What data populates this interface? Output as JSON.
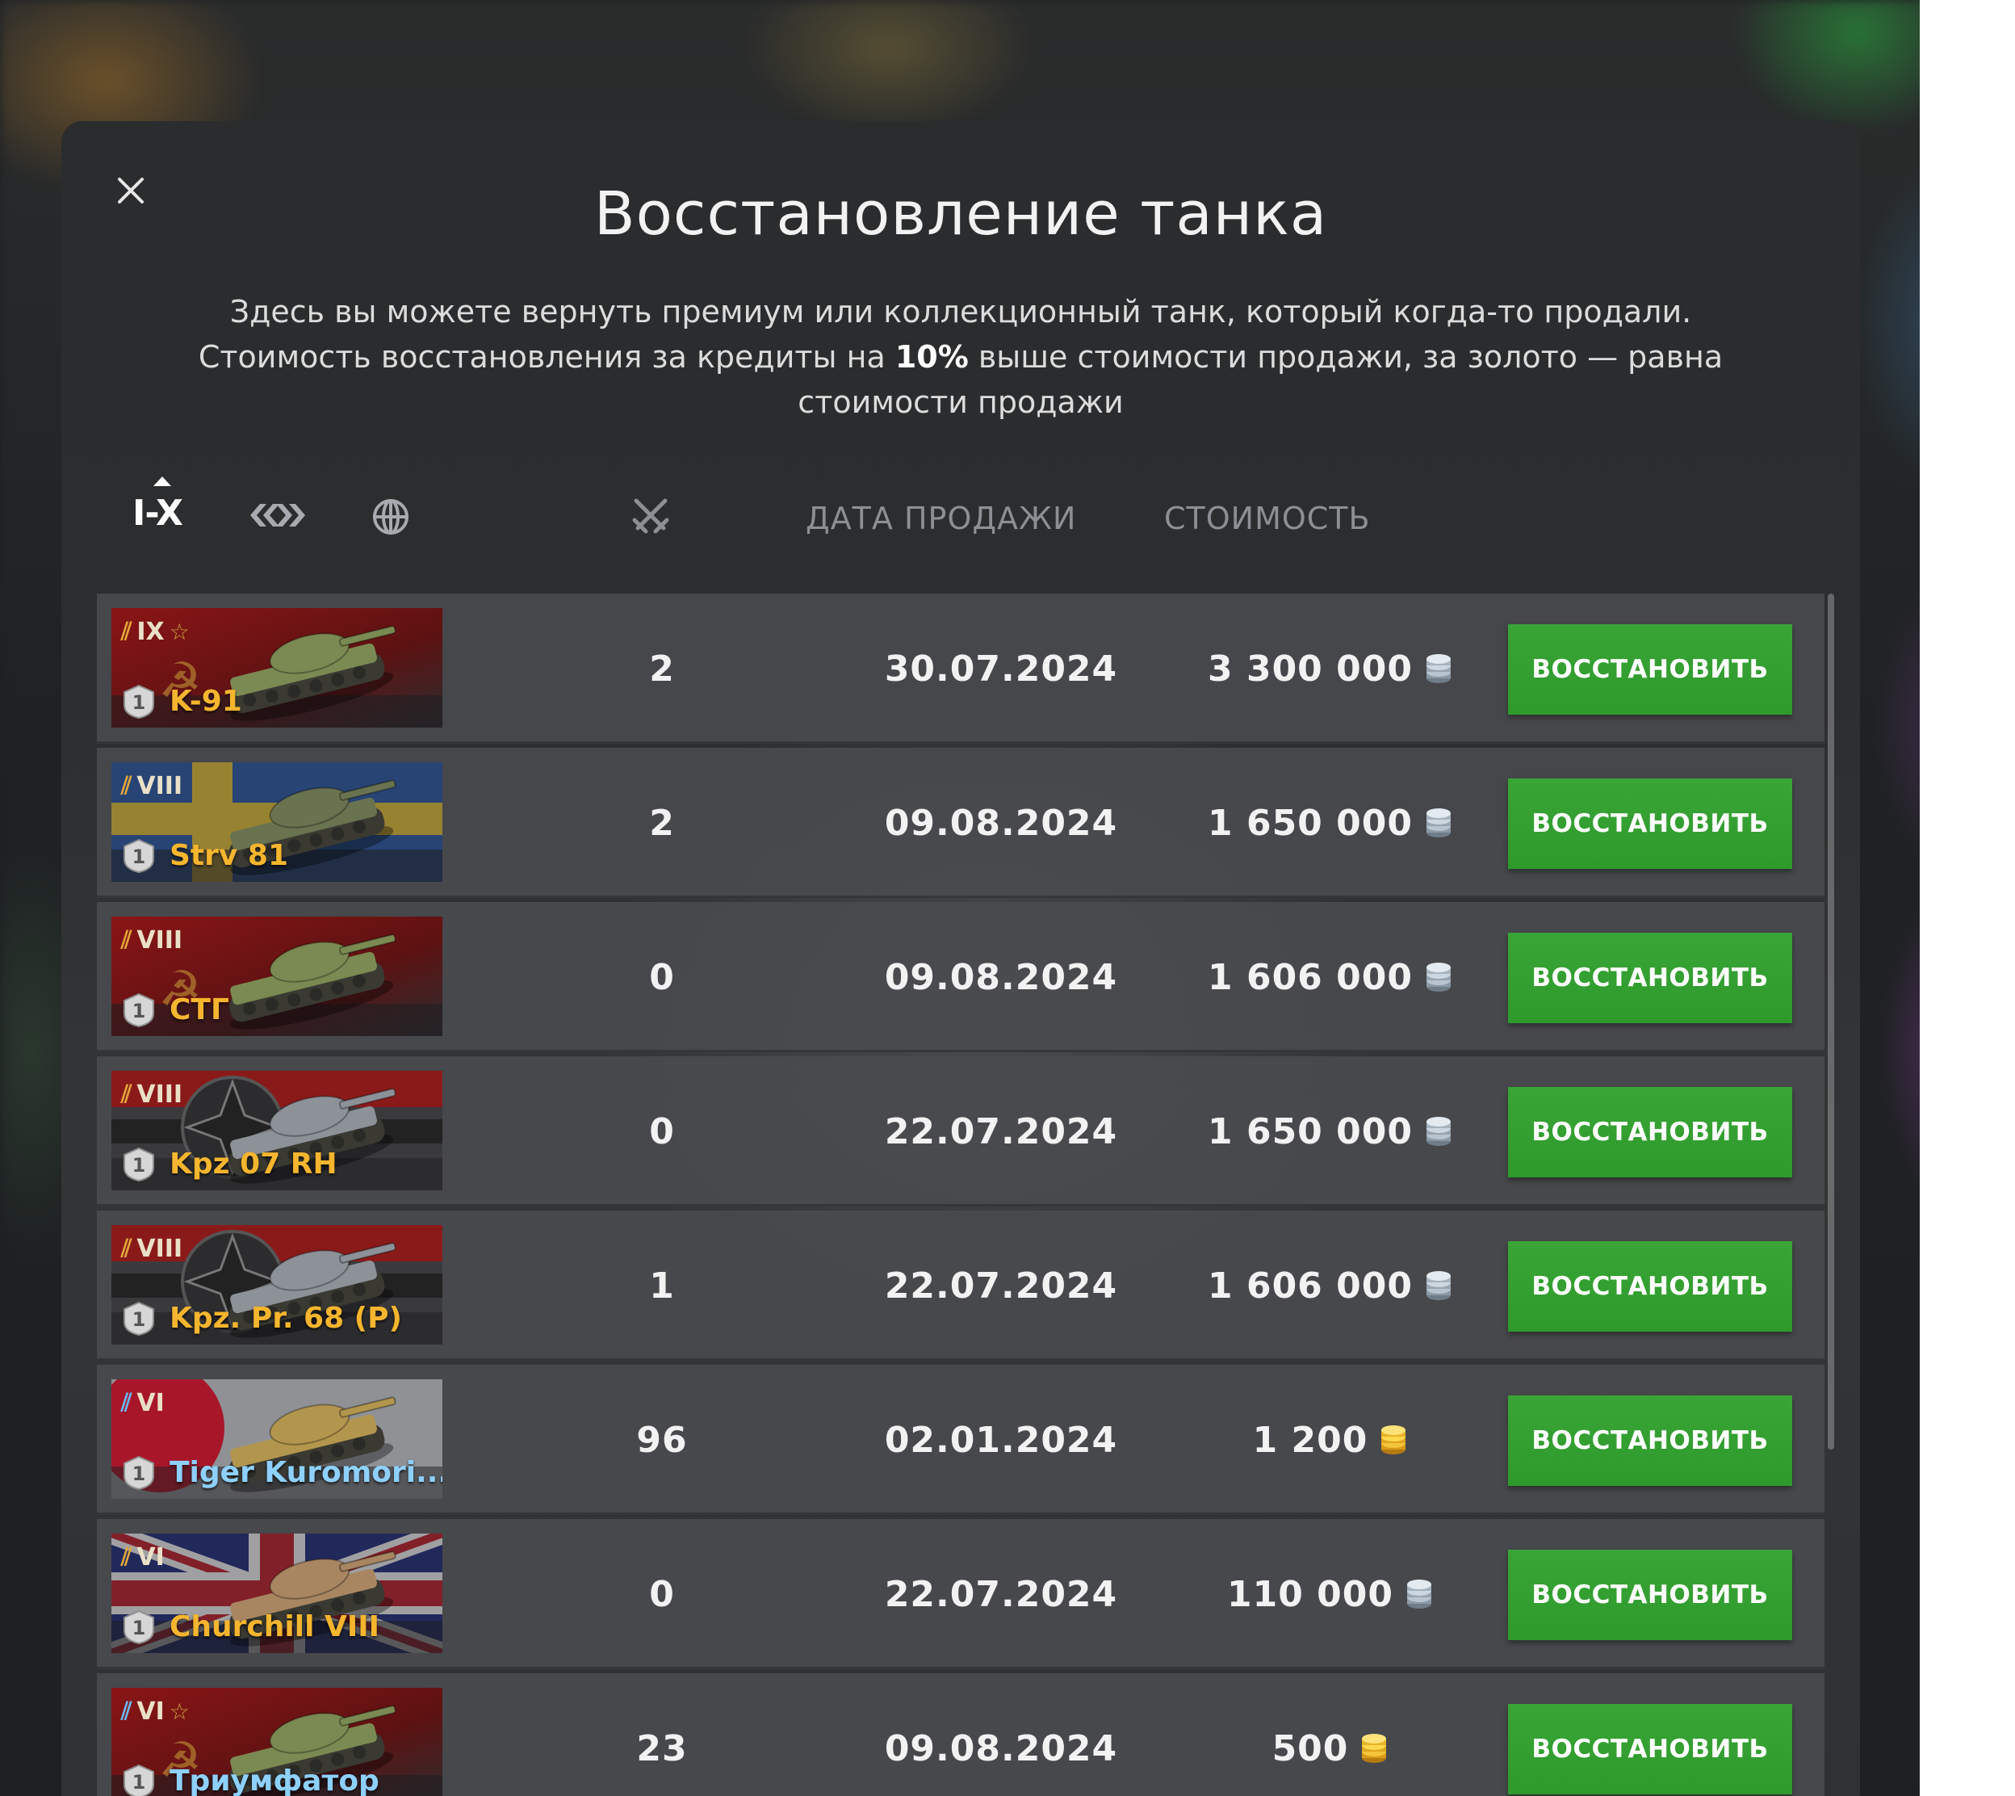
{
  "dialog": {
    "title": "Восстановление танка",
    "desc_line1": "Здесь вы можете вернуть премиум или коллекционный танк, который когда-то продали.",
    "desc_line2_pre": "Стоимость восстановления за кредиты на ",
    "desc_line2_bold": "10%",
    "desc_line2_post": " выше стоимости продажи, за золото — равна стоимости продажи"
  },
  "filters": {
    "tier_label": "I-X",
    "tier_sort": "ascending",
    "type_icon": "tank-type-icon",
    "nation_icon": "globe-icon"
  },
  "columns": {
    "battles_icon": "crossed-swords-icon",
    "sale_date": "ДАТА ПРОДАЖИ",
    "cost": "СТОИМОСТЬ"
  },
  "currency": {
    "credits_icon": "silver-coins-icon",
    "gold_icon": "gold-coins-icon"
  },
  "rows": [
    {
      "tier": "IX",
      "star": true,
      "name": "K-91",
      "flag": "ussr",
      "name_color": "gold",
      "mastery": "1",
      "battles": "2",
      "date": "30.07.2024",
      "cost": "3 300 000",
      "currency": "credits",
      "button": "ВОССТАНОВИТЬ"
    },
    {
      "tier": "VIII",
      "star": false,
      "name": "Strv 81",
      "flag": "sweden",
      "name_color": "gold",
      "mastery": "1",
      "battles": "2",
      "date": "09.08.2024",
      "cost": "1 650 000",
      "currency": "credits",
      "button": "ВОССТАНОВИТЬ"
    },
    {
      "tier": "VIII",
      "star": false,
      "name": "СТГ",
      "flag": "ussr",
      "name_color": "gold",
      "mastery": "1",
      "battles": "0",
      "date": "09.08.2024",
      "cost": "1 606 000",
      "currency": "credits",
      "button": "ВОССТАНОВИТЬ"
    },
    {
      "tier": "VIII",
      "star": false,
      "name": "Kpz 07 RH",
      "flag": "germany",
      "name_color": "gold",
      "mastery": "1",
      "battles": "0",
      "date": "22.07.2024",
      "cost": "1 650 000",
      "currency": "credits",
      "button": "ВОССТАНОВИТЬ"
    },
    {
      "tier": "VIII",
      "star": false,
      "name": "Kpz. Pr. 68 (P)",
      "flag": "germany",
      "name_color": "gold",
      "mastery": "1",
      "battles": "1",
      "date": "22.07.2024",
      "cost": "1 606 000",
      "currency": "credits",
      "button": "ВОССТАНОВИТЬ"
    },
    {
      "tier": "VI",
      "star": false,
      "name": "Tiger Kuromori...",
      "flag": "japan",
      "name_color": "blue",
      "mastery": "1",
      "battles": "96",
      "date": "02.01.2024",
      "cost": "1 200",
      "currency": "gold",
      "button": "ВОССТАНОВИТЬ"
    },
    {
      "tier": "VI",
      "star": false,
      "name": "Churchill VIII",
      "flag": "uk",
      "name_color": "gold",
      "mastery": "1",
      "battles": "0",
      "date": "22.07.2024",
      "cost": "110 000",
      "currency": "credits",
      "button": "ВОССТАНОВИТЬ"
    },
    {
      "tier": "VI",
      "star": true,
      "name": "Триумфатор",
      "flag": "ussr",
      "name_color": "blue",
      "mastery": "1",
      "battles": "23",
      "date": "09.08.2024",
      "cost": "500",
      "currency": "gold",
      "button": "ВОССТАНОВИТЬ"
    }
  ]
}
